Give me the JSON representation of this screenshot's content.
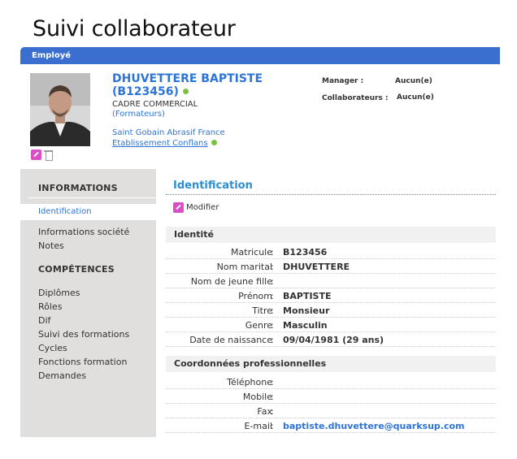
{
  "page": {
    "title": "Suivi collaborateur"
  },
  "section": {
    "title": "Employé"
  },
  "employee": {
    "name": "DHUVETTERE BAPTISTE",
    "id": "(B123456)",
    "role": "CADRE COMMERCIAL",
    "role_group": "(Formateurs)",
    "company": "Saint Gobain Abrasif France",
    "site": "Etablissement Conflans",
    "manager_label": "Manager :",
    "manager_value": "Aucun(e)",
    "collab_label": "Collaborateurs :",
    "collab_value": "Aucun(e)"
  },
  "sidebar": {
    "informations_head": "INFORMATIONS",
    "informations": [
      "Identification",
      "Informations société",
      "Notes"
    ],
    "competences_head": "COMPÉTENCES",
    "competences": [
      "Diplômes",
      "Rôles",
      "Dif",
      "Suivi des formations",
      "Cycles",
      "Fonctions formation",
      "Demandes"
    ]
  },
  "main": {
    "title": "Identification",
    "modify_label": "Modifier",
    "identity_head": "Identité",
    "identity_rows": [
      {
        "label": "Matricule",
        "value": "B123456"
      },
      {
        "label": "Nom marital",
        "value": "DHUVETTERE"
      },
      {
        "label": "Nom de jeune fille",
        "value": ""
      },
      {
        "label": "Prénom",
        "value": "BAPTISTE"
      },
      {
        "label": "Titre",
        "value": "Monsieur"
      },
      {
        "label": "Genre",
        "value": "Masculin"
      },
      {
        "label": "Date de naissance",
        "value": "09/04/1981 (29 ans)"
      }
    ],
    "contact_head": "Coordonnées professionnelles",
    "contact_rows": [
      {
        "label": "Téléphone",
        "value": ""
      },
      {
        "label": "Mobile",
        "value": ""
      },
      {
        "label": "Fax",
        "value": ""
      },
      {
        "label": "E-mail",
        "value": "baptiste.dhuvettere@quarksup.com"
      }
    ]
  },
  "colors": {
    "accent": "#3a6fd0",
    "link": "#2d74d8",
    "status_green": "#7ac142",
    "edit_pink": "#d94fc5"
  },
  "icons": {
    "status": "status-dot-icon",
    "edit": "pencil-edit-icon",
    "delete": "trash-icon"
  }
}
